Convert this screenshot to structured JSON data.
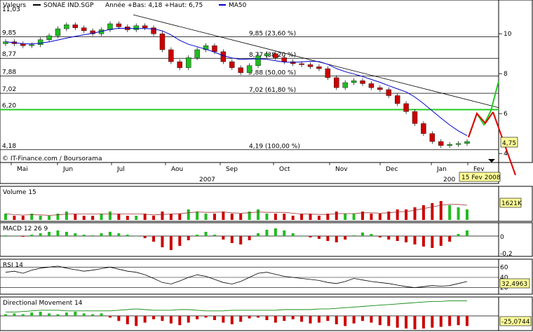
{
  "header": {
    "label": "Valeurs",
    "series_name": "SONAE IND.SGP",
    "series_color": "#000000",
    "info": "Année +Bas: 4,18 +Haut: 6,75",
    "ma_name": "MA50",
    "ma_color": "#0000cc",
    "copyright": "© IT-Finance.com / Boursorama"
  },
  "chart_data": [
    {
      "type": "candlestick",
      "title": "SONAE IND.SGP",
      "x_labels": [
        "Mai",
        "Jun",
        "Jul",
        "Aou",
        "Sep",
        "Oct",
        "Nov",
        "Dec",
        "Jan",
        "Fev"
      ],
      "year_labels": [
        "2007",
        "200"
      ],
      "ylim": [
        3.9,
        11.2
      ],
      "right_ticks": [
        "10",
        "8",
        "6",
        "4"
      ],
      "left_levels": [
        "11,03",
        "9,85",
        "8,77",
        "7,88",
        "7,02",
        "6,20",
        "4,18"
      ],
      "fib_levels": [
        {
          "value": 9.85,
          "label": "9,85 (23,60 %)"
        },
        {
          "value": 8.77,
          "label": "8,77 (38,20 %)"
        },
        {
          "value": 7.88,
          "label": "7,88 (50,00 %)"
        },
        {
          "value": 7.02,
          "label": "7,02 (61,80 %)"
        },
        {
          "value": 4.19,
          "label": "4,19 (100,00 %)"
        }
      ],
      "support_level": 6.2,
      "last_value": "4,75",
      "date_marker": "15 Fev 2008",
      "weekly_closes": [
        9.6,
        9.5,
        9.4,
        9.45,
        9.7,
        9.9,
        10.25,
        10.45,
        10.3,
        10.15,
        10.0,
        10.2,
        10.5,
        10.35,
        10.2,
        10.4,
        10.3,
        10.0,
        9.2,
        8.6,
        8.3,
        8.8,
        9.2,
        9.4,
        9.1,
        8.6,
        8.3,
        8.05,
        8.4,
        8.9,
        9.0,
        8.8,
        8.6,
        8.5,
        8.45,
        8.35,
        8.25,
        7.8,
        7.3,
        7.55,
        7.65,
        7.5,
        7.3,
        7.2,
        6.9,
        6.5,
        6.1,
        5.5,
        5.0,
        4.6,
        4.4,
        4.45,
        4.5,
        4.6
      ]
    },
    {
      "type": "bar",
      "title": "Volume 15",
      "last_value": "1621K",
      "values": [
        3,
        2,
        2,
        3,
        2,
        2,
        3,
        4,
        3,
        2,
        2,
        3,
        4,
        3,
        2,
        2,
        3,
        2,
        4,
        3,
        3,
        5,
        4,
        3,
        3,
        4,
        3,
        3,
        4,
        5,
        3,
        3,
        3,
        2,
        3,
        3,
        2,
        3,
        4,
        3,
        3,
        4,
        3,
        3,
        4,
        5,
        5,
        6,
        7,
        8,
        9,
        7,
        6,
        5
      ]
    },
    {
      "type": "histogram",
      "title": "MACD 12 26 9",
      "ticks": [
        "0",
        "-0,2"
      ],
      "values": [
        0.01,
        0.0,
        -0.01,
        0.02,
        0.04,
        0.06,
        0.08,
        0.06,
        0.04,
        0.02,
        0.01,
        0.04,
        0.06,
        0.04,
        0.02,
        0.0,
        -0.03,
        -0.08,
        -0.16,
        -0.2,
        -0.14,
        -0.06,
        0.02,
        0.06,
        0.02,
        -0.05,
        -0.1,
        -0.12,
        -0.06,
        0.04,
        0.09,
        0.11,
        0.08,
        0.04,
        0.0,
        -0.02,
        -0.04,
        -0.07,
        -0.09,
        -0.05,
        0.01,
        0.05,
        0.03,
        -0.02,
        -0.05,
        -0.07,
        -0.09,
        -0.12,
        -0.15,
        -0.17,
        -0.14,
        -0.08,
        0.03,
        0.08
      ]
    },
    {
      "type": "line",
      "title": "RSI 14",
      "ticks": [
        "60",
        "40",
        "20"
      ],
      "last_value": "32,4963",
      "ylim": [
        10,
        70
      ],
      "values": [
        50,
        52,
        48,
        54,
        58,
        60,
        62,
        58,
        55,
        52,
        54,
        57,
        60,
        56,
        52,
        50,
        45,
        38,
        30,
        27,
        33,
        40,
        45,
        42,
        36,
        30,
        27,
        32,
        40,
        48,
        50,
        46,
        42,
        40,
        38,
        36,
        34,
        30,
        28,
        32,
        38,
        35,
        32,
        30,
        28,
        25,
        22,
        20,
        22,
        24,
        23,
        24,
        28,
        32
      ]
    },
    {
      "type": "histogram",
      "title": "Directional Movement 14",
      "last_value": "-25,0744",
      "values": [
        2,
        3,
        2,
        4,
        5,
        3,
        2,
        4,
        5,
        3,
        2,
        3,
        -2,
        -6,
        -10,
        -12,
        -8,
        -4,
        -6,
        -9,
        -11,
        -8,
        -4,
        -2,
        -5,
        -8,
        -10,
        -7,
        -3,
        -2,
        -5,
        -8,
        -6,
        -4,
        -7,
        -9,
        -8,
        -6,
        -10,
        -12,
        -9,
        -6,
        -8,
        -11,
        -12,
        -14,
        -15,
        -16,
        -15,
        -14,
        -13,
        -12,
        -11,
        -12
      ],
      "adx_values": [
        16,
        16,
        17,
        18,
        19,
        19,
        19,
        18,
        18,
        18,
        18,
        18,
        18,
        19,
        20,
        21,
        20,
        19,
        19,
        19,
        20,
        20,
        19,
        18,
        18,
        18,
        19,
        19,
        19,
        19,
        19,
        19,
        20,
        20,
        20,
        20,
        21,
        21,
        22,
        23,
        24,
        25,
        26,
        27,
        28,
        29,
        30,
        31,
        32,
        33,
        33,
        34,
        34,
        34
      ]
    }
  ]
}
